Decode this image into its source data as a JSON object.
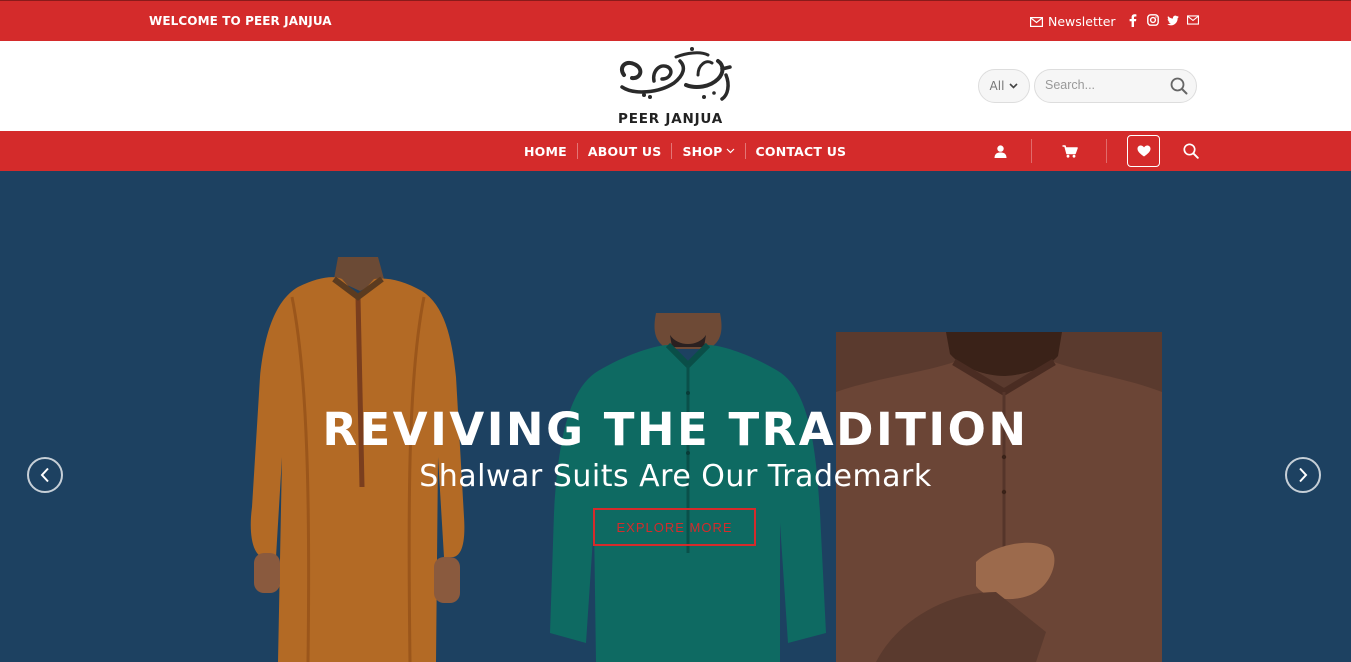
{
  "topbar": {
    "welcome": "WELCOME TO PEER JANJUA",
    "newsletter": "Newsletter",
    "socials": [
      "facebook-icon",
      "instagram-icon",
      "twitter-icon",
      "email-icon"
    ]
  },
  "header": {
    "logo_text": "PEER JANJUA",
    "category_select": "All",
    "search_placeholder": "Search..."
  },
  "nav": {
    "items": [
      "HOME",
      "ABOUT US",
      "SHOP",
      "CONTACT US"
    ],
    "icons": [
      "account-icon",
      "cart-icon",
      "wishlist-icon",
      "search-icon"
    ]
  },
  "hero": {
    "heading": "REVIVING THE TRADITION",
    "subheading": "Shalwar Suits Are Our Trademark",
    "button": "EXPLORE MORE"
  },
  "colors": {
    "brand_red": "#d42b2b",
    "hero_bg": "#1d4161"
  }
}
